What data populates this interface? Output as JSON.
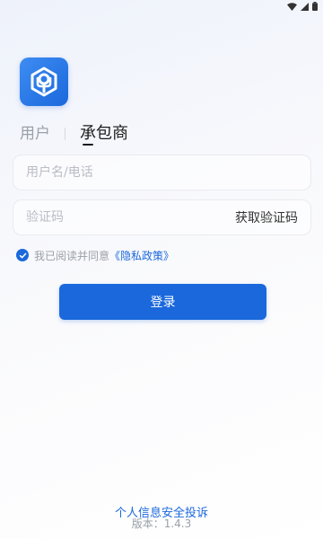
{
  "status_bar": {
    "icons": [
      "wifi-icon",
      "signal-icon",
      "battery-icon"
    ]
  },
  "app": {
    "logo_icon": "app-logo-icon",
    "brand_color": "#1a68dc"
  },
  "role_tabs": [
    {
      "label": "用户",
      "active": false
    },
    {
      "label": "承包商",
      "active": true
    }
  ],
  "form": {
    "phone_placeholder": "用户名/电话",
    "phone_value": "",
    "code_placeholder": "验证码",
    "code_value": "",
    "get_code_label": "获取验证码"
  },
  "agreement": {
    "checked": true,
    "text": "我已阅读并同意",
    "link_label": "《隐私政策》"
  },
  "login_label": "登录",
  "footer": {
    "complaint_link": "个人信息安全投诉",
    "version": "版本：1.4.3"
  }
}
